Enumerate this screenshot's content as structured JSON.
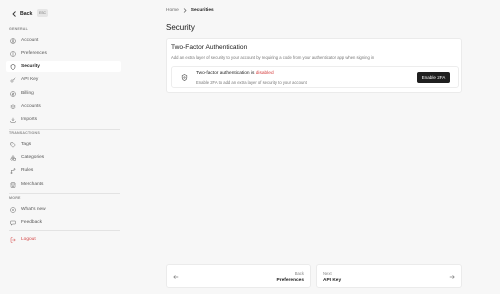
{
  "sidebar": {
    "back_label": "Back",
    "esc_label": "ESC",
    "sections": {
      "general": "GENERAL",
      "transactions": "TRANSACTIONS",
      "more": "MORE"
    },
    "items": {
      "account": "Account",
      "preferences": "Preferences",
      "security": "Security",
      "api_key": "API Key",
      "billing": "Billing",
      "accounts": "Accounts",
      "imports": "Imports",
      "tags": "Tags",
      "categories": "Categories",
      "rules": "Rules",
      "merchants": "Merchants",
      "whats_new": "What's new",
      "feedback": "Feedback",
      "logout": "Logout"
    },
    "active_item": "security",
    "logout_color": "#d44444"
  },
  "breadcrumb": {
    "home": "Home",
    "current": "Securities"
  },
  "page_title": "Security",
  "two_factor": {
    "title": "Two-Factor Authentication",
    "description": "Add an extra layer of security to your account by requiring a code from your authenticator app when signing in",
    "status_prefix": "Two-factor authentication is",
    "status_value": "disabled",
    "status_color": "#d43b3b",
    "hint": "Enable 2FA to add an extra layer of security to your account",
    "button_label": "Enable 2FA"
  },
  "pager": {
    "prev_small": "Back",
    "prev_label": "Preferences",
    "next_small": "Next",
    "next_label": "API Key"
  },
  "icons": {
    "back": "chevron-left-icon",
    "account": "user-circle-icon",
    "preferences": "sliders-icon",
    "security": "shield-icon",
    "api_key": "key-icon",
    "billing": "credit-card-icon",
    "accounts": "layers-icon",
    "imports": "download-icon",
    "tags": "tag-icon",
    "categories": "shapes-icon",
    "rules": "git-branch-icon",
    "merchants": "store-icon",
    "whats_new": "sparkle-icon",
    "feedback": "message-icon",
    "logout": "logout-icon"
  }
}
